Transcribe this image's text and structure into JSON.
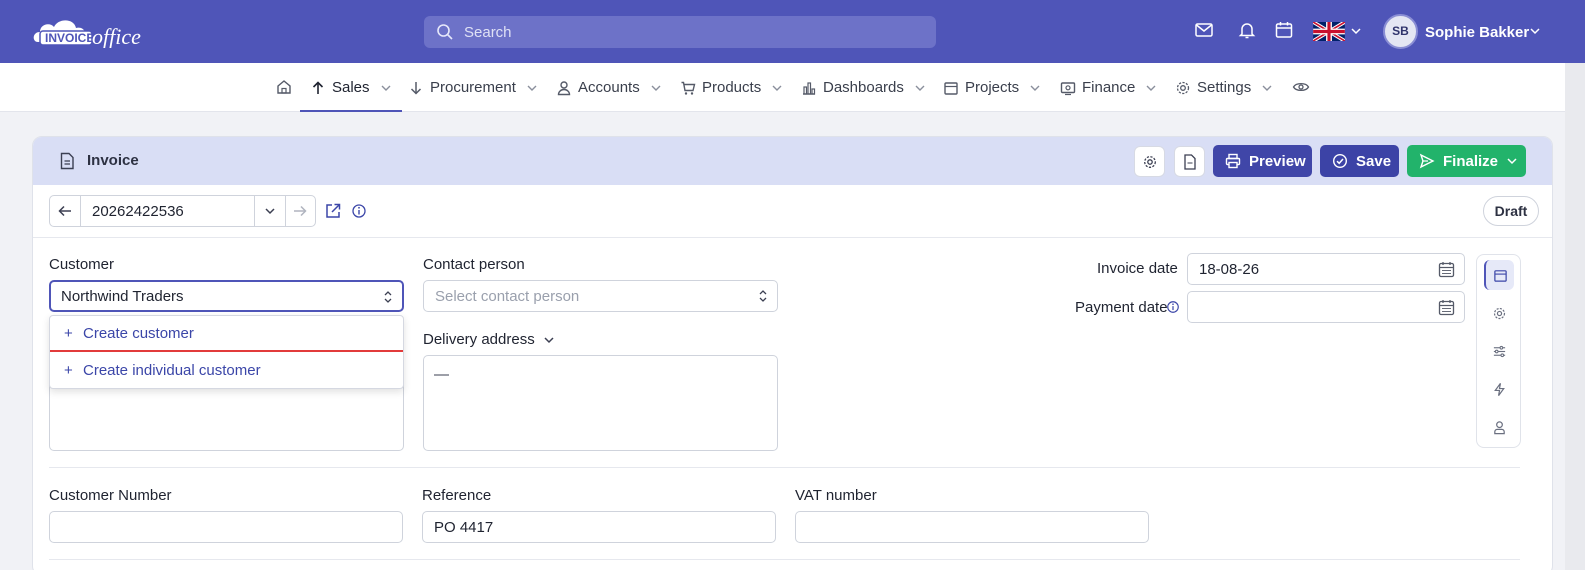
{
  "app": {
    "logo_text": "invoiceoffice"
  },
  "search": {
    "placeholder": "Search"
  },
  "user": {
    "initials": "SB",
    "name": "Sophie Bakker"
  },
  "nav": {
    "items": [
      {
        "label": "Sales",
        "icon": "arrow-up-icon",
        "active": true
      },
      {
        "label": "Procurement",
        "icon": "arrow-down-icon"
      },
      {
        "label": "Accounts",
        "icon": "user-icon"
      },
      {
        "label": "Products",
        "icon": "cart-icon"
      },
      {
        "label": "Dashboards",
        "icon": "bar-chart-icon"
      },
      {
        "label": "Projects",
        "icon": "calendar-icon"
      },
      {
        "label": "Finance",
        "icon": "wallet-icon"
      },
      {
        "label": "Settings",
        "icon": "gear-icon"
      }
    ]
  },
  "doc": {
    "title": "Invoice",
    "preview_label": "Preview",
    "save_label": "Save",
    "finalize_label": "Finalize",
    "number": "20262422536",
    "status": "Draft"
  },
  "form": {
    "customer_label": "Customer",
    "customer_value": "Northwind Traders",
    "contact_label": "Contact person",
    "contact_placeholder": "Select contact person",
    "delivery_label": "Delivery address",
    "delivery_value": "—",
    "invoice_date_label": "Invoice date",
    "invoice_date_value": "18-08-26",
    "payment_date_label": "Payment date",
    "payment_date_value": "",
    "customer_number_label": "Customer Number",
    "customer_number_value": "",
    "reference_label": "Reference",
    "reference_value": "PO 4417",
    "vat_label": "VAT number",
    "vat_value": ""
  },
  "customer_dropdown": {
    "items": [
      {
        "label": "Create customer"
      },
      {
        "label": "Create individual customer"
      }
    ]
  },
  "colors": {
    "topbar": "#4f55b8",
    "preview": "#4046a8",
    "save": "#3c43a6",
    "finalize": "#22b36b",
    "danger_underline": "#e23b3b"
  }
}
